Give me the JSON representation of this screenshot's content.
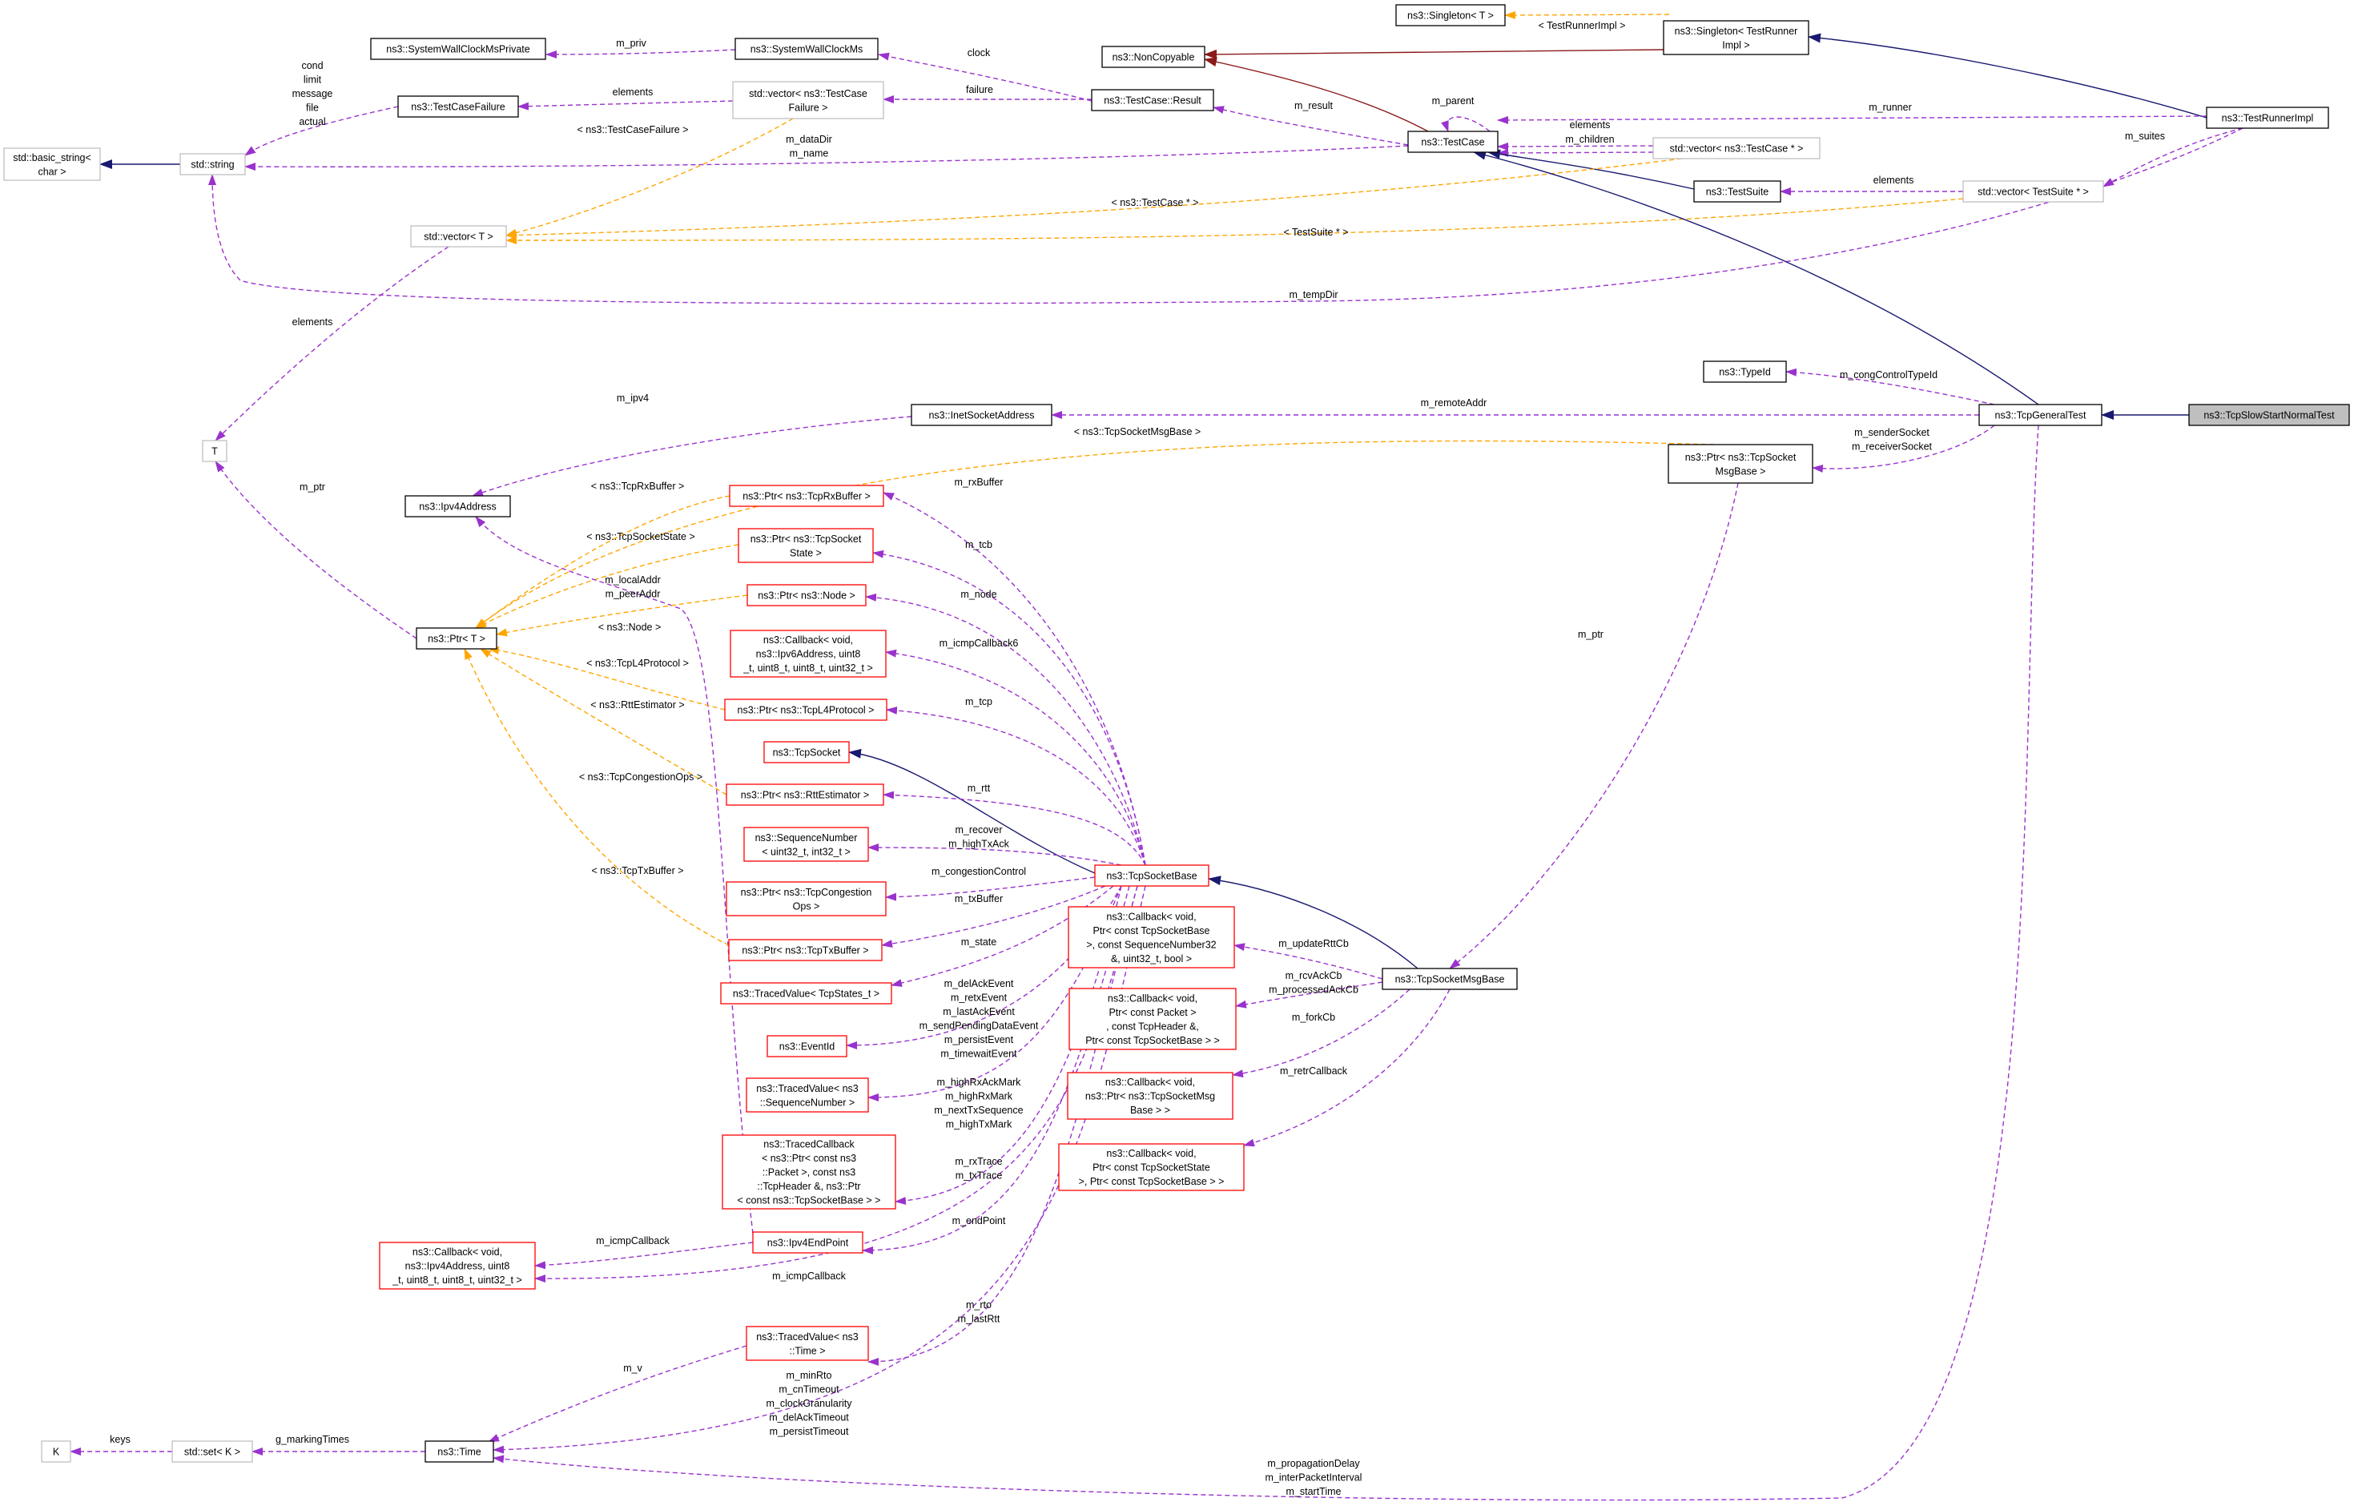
{
  "colors": {
    "border_black": "#000000",
    "border_red": "#ff0000",
    "border_gray": "#bfbfbf",
    "fill_highlight": "#bfbfbf",
    "edge_usage": "#9a32cd",
    "edge_template": "#ffa500",
    "edge_inherit_public": "#191970",
    "edge_inherit_private": "#8b1a1a"
  },
  "nodes": [
    {
      "id": "sysclockpriv",
      "lines": [
        "ns3::SystemWallClockMsPrivate"
      ],
      "border": "black"
    },
    {
      "id": "sysclock",
      "lines": [
        "ns3::SystemWallClockMs"
      ],
      "border": "black"
    },
    {
      "id": "noncopyable",
      "lines": [
        "ns3::NonCopyable"
      ],
      "border": "black"
    },
    {
      "id": "singletonT",
      "lines": [
        "ns3::Singleton< T >"
      ],
      "border": "black"
    },
    {
      "id": "singletonTR",
      "lines": [
        "ns3::Singleton< TestRunner",
        "Impl >"
      ],
      "border": "black"
    },
    {
      "id": "testrunnerimpl",
      "lines": [
        "ns3::TestRunnerImpl"
      ],
      "border": "black"
    },
    {
      "id": "testcasefailure",
      "lines": [
        "ns3::TestCaseFailure"
      ],
      "border": "black"
    },
    {
      "id": "vecfailure",
      "lines": [
        "std::vector< ns3::TestCase",
        "Failure >"
      ],
      "border": "gray"
    },
    {
      "id": "tcresult",
      "lines": [
        "ns3::TestCase::Result"
      ],
      "border": "black"
    },
    {
      "id": "basicstring",
      "lines": [
        "std::basic_string<",
        "char >"
      ],
      "border": "gray"
    },
    {
      "id": "stdstring",
      "lines": [
        "std::string"
      ],
      "border": "gray"
    },
    {
      "id": "testcase",
      "lines": [
        "ns3::TestCase"
      ],
      "border": "black"
    },
    {
      "id": "vectestcase",
      "lines": [
        "std::vector< ns3::TestCase * >"
      ],
      "border": "gray"
    },
    {
      "id": "testsuite",
      "lines": [
        "ns3::TestSuite"
      ],
      "border": "black"
    },
    {
      "id": "vectestsuite",
      "lines": [
        "std::vector< TestSuite * >"
      ],
      "border": "gray"
    },
    {
      "id": "vecT",
      "lines": [
        "std::vector< T >"
      ],
      "border": "gray"
    },
    {
      "id": "typeid",
      "lines": [
        "ns3::TypeId"
      ],
      "border": "black"
    },
    {
      "id": "inetsock",
      "lines": [
        "ns3::InetSocketAddress"
      ],
      "border": "black"
    },
    {
      "id": "tcpgeneral",
      "lines": [
        "ns3::TcpGeneralTest"
      ],
      "border": "black"
    },
    {
      "id": "tcpslow",
      "lines": [
        "ns3::TcpSlowStartNormalTest"
      ],
      "border": "black",
      "highlight": true
    },
    {
      "id": "T",
      "lines": [
        "T"
      ],
      "border": "gray"
    },
    {
      "id": "ptrmsgbase",
      "lines": [
        "ns3::Ptr< ns3::TcpSocket",
        "MsgBase >"
      ],
      "border": "black"
    },
    {
      "id": "ipv4addr",
      "lines": [
        "ns3::Ipv4Address"
      ],
      "border": "black"
    },
    {
      "id": "ptrrx",
      "lines": [
        "ns3::Ptr< ns3::TcpRxBuffer >"
      ],
      "border": "red"
    },
    {
      "id": "ptrstate",
      "lines": [
        "ns3::Ptr< ns3::TcpSocket",
        "State >"
      ],
      "border": "red"
    },
    {
      "id": "ptrnode",
      "lines": [
        "ns3::Ptr< ns3::Node >"
      ],
      "border": "red"
    },
    {
      "id": "ptrT",
      "lines": [
        "ns3::Ptr< T >"
      ],
      "border": "black"
    },
    {
      "id": "cbicmp6",
      "lines": [
        "ns3::Callback< void,",
        "ns3::Ipv6Address, uint8",
        "_t, uint8_t, uint8_t, uint32_t >"
      ],
      "border": "red"
    },
    {
      "id": "ptrl4",
      "lines": [
        "ns3::Ptr< ns3::TcpL4Protocol >"
      ],
      "border": "red"
    },
    {
      "id": "tcpsocket",
      "lines": [
        "ns3::TcpSocket"
      ],
      "border": "red"
    },
    {
      "id": "ptrrtt",
      "lines": [
        "ns3::Ptr< ns3::RttEstimator >"
      ],
      "border": "red"
    },
    {
      "id": "seqnum",
      "lines": [
        "ns3::SequenceNumber",
        "< uint32_t, int32_t >"
      ],
      "border": "red"
    },
    {
      "id": "tcpsocketbase",
      "lines": [
        "ns3::TcpSocketBase"
      ],
      "border": "red"
    },
    {
      "id": "ptrcong",
      "lines": [
        "ns3::Ptr< ns3::TcpCongestion",
        "Ops >"
      ],
      "border": "red"
    },
    {
      "id": "ptrtx",
      "lines": [
        "ns3::Ptr< ns3::TcpTxBuffer >"
      ],
      "border": "red"
    },
    {
      "id": "cbrtt",
      "lines": [
        "ns3::Callback< void,",
        "Ptr< const TcpSocketBase",
        ">, const SequenceNumber32",
        "&, uint32_t, bool >"
      ],
      "border": "red"
    },
    {
      "id": "tcpsocketmsgbase",
      "lines": [
        "ns3::TcpSocketMsgBase"
      ],
      "border": "black"
    },
    {
      "id": "tvstates",
      "lines": [
        "ns3::TracedValue< TcpStates_t >"
      ],
      "border": "red"
    },
    {
      "id": "cbpacket",
      "lines": [
        "ns3::Callback< void,",
        "Ptr< const Packet >",
        ", const TcpHeader &,",
        "Ptr< const TcpSocketBase > >"
      ],
      "border": "red"
    },
    {
      "id": "eventid",
      "lines": [
        "ns3::EventId"
      ],
      "border": "red"
    },
    {
      "id": "tvseq",
      "lines": [
        "ns3::TracedValue< ns3",
        "::SequenceNumber >"
      ],
      "border": "red"
    },
    {
      "id": "cbfork",
      "lines": [
        "ns3::Callback< void,",
        "ns3::Ptr< ns3::TcpSocketMsg",
        "Base > >"
      ],
      "border": "red"
    },
    {
      "id": "cbretr",
      "lines": [
        "ns3::Callback< void,",
        "Ptr< const TcpSocketState",
        ">, Ptr< const TcpSocketBase > >"
      ],
      "border": "red"
    },
    {
      "id": "tracedcb",
      "lines": [
        "ns3::TracedCallback",
        "< ns3::Ptr< const ns3",
        "::Packet >, const ns3",
        "::TcpHeader &, ns3::Ptr",
        "< const ns3::TcpSocketBase > >"
      ],
      "border": "red"
    },
    {
      "id": "ipv4ep",
      "lines": [
        "ns3::Ipv4EndPoint"
      ],
      "border": "red"
    },
    {
      "id": "cbicmp4",
      "lines": [
        "ns3::Callback< void,",
        "ns3::Ipv4Address, uint8",
        "_t, uint8_t, uint8_t, uint32_t >"
      ],
      "border": "red"
    },
    {
      "id": "tvtime",
      "lines": [
        "ns3::TracedValue< ns3",
        "::Time >"
      ],
      "border": "red"
    },
    {
      "id": "K",
      "lines": [
        "K"
      ],
      "border": "gray"
    },
    {
      "id": "setK",
      "lines": [
        "std::set< K >"
      ],
      "border": "gray"
    },
    {
      "id": "time",
      "lines": [
        "ns3::Time"
      ],
      "border": "black"
    }
  ],
  "edge_labels": [
    {
      "id": "m_priv",
      "lines": [
        "m_priv"
      ]
    },
    {
      "id": "clock",
      "lines": [
        "clock"
      ]
    },
    {
      "id": "failure",
      "lines": [
        "failure"
      ]
    },
    {
      "id": "elements_failure",
      "lines": [
        "elements"
      ]
    },
    {
      "id": "string_members",
      "lines": [
        "cond",
        "limit",
        "message",
        "file",
        "actual"
      ]
    },
    {
      "id": "tr_impl",
      "lines": [
        "< TestRunnerImpl >"
      ]
    },
    {
      "id": "m_result",
      "lines": [
        "m_result"
      ]
    },
    {
      "id": "m_parent",
      "lines": [
        "m_parent"
      ]
    },
    {
      "id": "elements_tc",
      "lines": [
        "elements"
      ]
    },
    {
      "id": "m_children",
      "lines": [
        "m_children"
      ]
    },
    {
      "id": "m_runner",
      "lines": [
        "m_runner"
      ]
    },
    {
      "id": "m_suites",
      "lines": [
        "m_suites"
      ]
    },
    {
      "id": "elements_ts",
      "lines": [
        "elements"
      ]
    },
    {
      "id": "testcasefailure_t",
      "lines": [
        "< ns3::TestCaseFailure >"
      ]
    },
    {
      "id": "datadir",
      "lines": [
        "m_dataDir",
        "m_name"
      ]
    },
    {
      "id": "testcase_ptr_t",
      "lines": [
        "< ns3::TestCase * >"
      ]
    },
    {
      "id": "testsuite_ptr_t",
      "lines": [
        "< TestSuite * >"
      ]
    },
    {
      "id": "m_tempDir",
      "lines": [
        "m_tempDir"
      ]
    },
    {
      "id": "elements_T",
      "lines": [
        "elements"
      ]
    },
    {
      "id": "m_congControl",
      "lines": [
        "m_congControlTypeId"
      ]
    },
    {
      "id": "m_remoteAddr",
      "lines": [
        "m_remoteAddr"
      ]
    },
    {
      "id": "m_ipv4",
      "lines": [
        "m_ipv4"
      ]
    },
    {
      "id": "msgbase_t",
      "lines": [
        "< ns3::TcpSocketMsgBase >"
      ]
    },
    {
      "id": "sockets",
      "lines": [
        "m_senderSocket",
        "m_receiverSocket"
      ]
    },
    {
      "id": "m_ptr_T",
      "lines": [
        "m_ptr"
      ]
    },
    {
      "id": "rxbuffer_t",
      "lines": [
        "< ns3::TcpRxBuffer >"
      ]
    },
    {
      "id": "m_rxBuffer",
      "lines": [
        "m_rxBuffer"
      ]
    },
    {
      "id": "socketstate_t",
      "lines": [
        "< ns3::TcpSocketState >"
      ]
    },
    {
      "id": "m_tcb",
      "lines": [
        "m_tcb"
      ]
    },
    {
      "id": "localaddr",
      "lines": [
        "m_localAddr",
        "m_peerAddr"
      ]
    },
    {
      "id": "m_ptr_msg",
      "lines": [
        "m_ptr"
      ]
    },
    {
      "id": "node_t",
      "lines": [
        "< ns3::Node >"
      ]
    },
    {
      "id": "m_node",
      "lines": [
        "m_node"
      ]
    },
    {
      "id": "m_icmpCallback6",
      "lines": [
        "m_icmpCallback6"
      ]
    },
    {
      "id": "l4_t",
      "lines": [
        "< ns3::TcpL4Protocol >"
      ]
    },
    {
      "id": "m_tcp",
      "lines": [
        "m_tcp"
      ]
    },
    {
      "id": "rtt_t",
      "lines": [
        "< ns3::RttEstimator >"
      ]
    },
    {
      "id": "m_rtt",
      "lines": [
        "m_rtt"
      ]
    },
    {
      "id": "cong_t",
      "lines": [
        "< ns3::TcpCongestionOps >"
      ]
    },
    {
      "id": "recover",
      "lines": [
        "m_recover",
        "m_highTxAck"
      ]
    },
    {
      "id": "m_congestionControl",
      "lines": [
        "m_congestionControl"
      ]
    },
    {
      "id": "txbuffer_t",
      "lines": [
        "< ns3::TcpTxBuffer >"
      ]
    },
    {
      "id": "m_txBuffer",
      "lines": [
        "m_txBuffer"
      ]
    },
    {
      "id": "m_updateRttCb",
      "lines": [
        "m_updateRttCb"
      ]
    },
    {
      "id": "m_state",
      "lines": [
        "m_state"
      ]
    },
    {
      "id": "rcvack",
      "lines": [
        "m_rcvAckCb",
        "m_processedAckCb"
      ]
    },
    {
      "id": "events",
      "lines": [
        "m_delAckEvent",
        "m_retxEvent",
        "m_lastAckEvent",
        "m_sendPendingDataEvent",
        "m_persistEvent",
        "m_timewaitEvent"
      ]
    },
    {
      "id": "m_forkCb",
      "lines": [
        "m_forkCb"
      ]
    },
    {
      "id": "m_retrCallback",
      "lines": [
        "m_retrCallback"
      ]
    },
    {
      "id": "marks",
      "lines": [
        "m_highRxAckMark",
        "m_highRxMark",
        "m_nextTxSequence",
        "m_highTxMark"
      ]
    },
    {
      "id": "traces",
      "lines": [
        "m_rxTrace",
        "m_txTrace"
      ]
    },
    {
      "id": "m_endPoint",
      "lines": [
        "m_endPoint"
      ]
    },
    {
      "id": "m_icmpCallback_a",
      "lines": [
        "m_icmpCallback"
      ]
    },
    {
      "id": "m_icmpCallback_b",
      "lines": [
        "m_icmpCallback"
      ]
    },
    {
      "id": "rto",
      "lines": [
        "m_rto",
        "m_lastRtt"
      ]
    },
    {
      "id": "m_v",
      "lines": [
        "m_v"
      ]
    },
    {
      "id": "timeouts",
      "lines": [
        "m_minRto",
        "m_cnTimeout",
        "m_clockGranularity",
        "m_delAckTimeout",
        "m_persistTimeout"
      ]
    },
    {
      "id": "keys",
      "lines": [
        "keys"
      ]
    },
    {
      "id": "g_markingTimes",
      "lines": [
        "g_markingTimes"
      ]
    },
    {
      "id": "propagation",
      "lines": [
        "m_propagationDelay",
        "m_interPacketInterval",
        "m_startTime"
      ]
    }
  ]
}
